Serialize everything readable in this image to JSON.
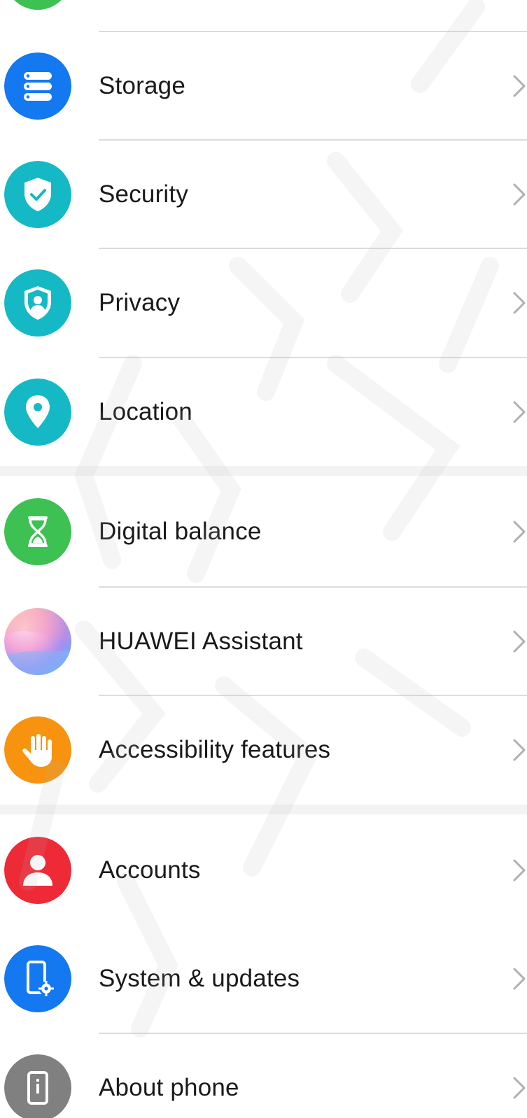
{
  "settings_list": {
    "items": [
      {
        "label": "Storage",
        "icon": "storage-icon",
        "color": "#1478f0"
      },
      {
        "label": "Security",
        "icon": "shield-check-icon",
        "color": "#15b9c5"
      },
      {
        "label": "Privacy",
        "icon": "privacy-icon",
        "color": "#15b9c5"
      },
      {
        "label": "Location",
        "icon": "location-pin-icon",
        "color": "#15b9c5"
      },
      {
        "label": "Digital balance",
        "icon": "hourglass-icon",
        "color": "#3cc152"
      },
      {
        "label": "HUAWEI Assistant",
        "icon": "huawei-assistant-icon",
        "color": "#b690ef"
      },
      {
        "label": "Accessibility features",
        "icon": "hand-icon",
        "color": "#f7930f"
      },
      {
        "label": "Accounts",
        "icon": "person-icon",
        "color": "#ee2a37"
      },
      {
        "label": "System & updates",
        "icon": "phone-gear-icon",
        "color": "#1478f0"
      },
      {
        "label": "About phone",
        "icon": "phone-info-icon",
        "color": "#808080"
      }
    ]
  },
  "colors": {
    "divider": "#dcdcdc",
    "section_gap": "#f3f3f3",
    "text": "#1a1a1a",
    "chevron": "#b0b0b0",
    "top_partial_icon": "#3cc152"
  }
}
